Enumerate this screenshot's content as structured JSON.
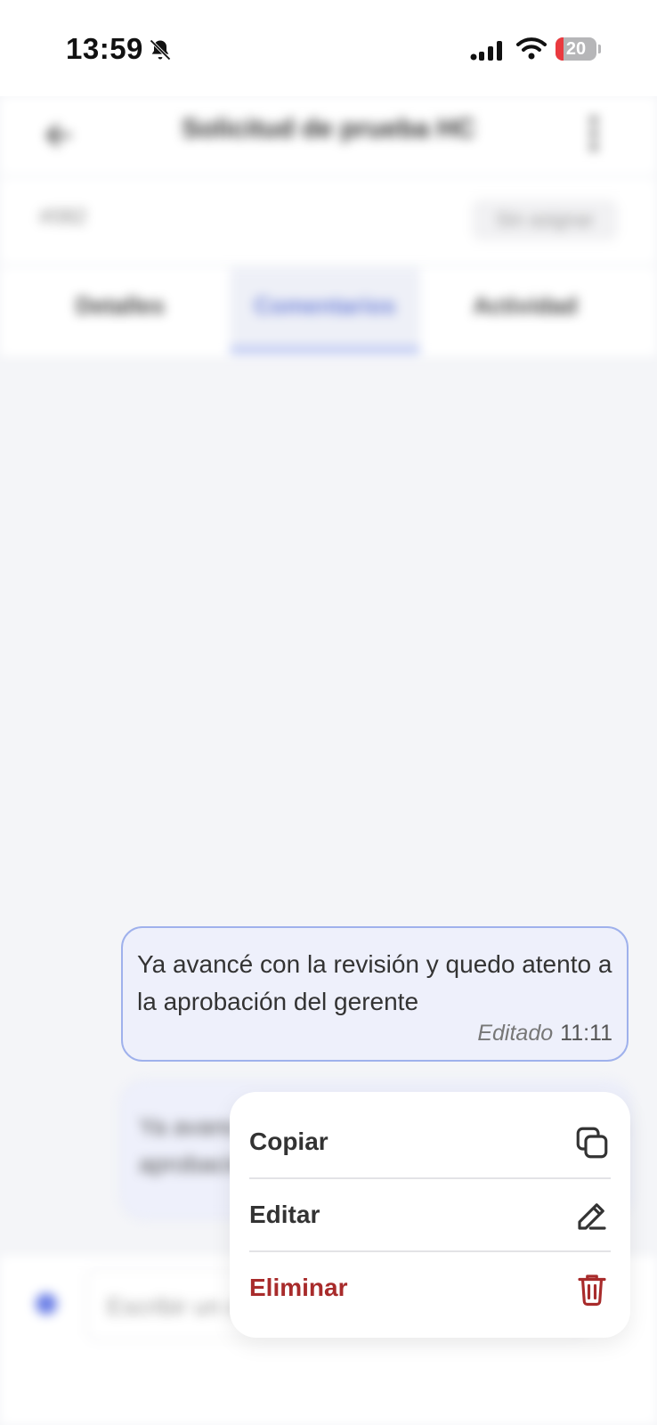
{
  "status_bar": {
    "time": "13:59",
    "battery": "20",
    "battery_level": 0.2
  },
  "header": {
    "title": "Solicitud de prueba HC"
  },
  "info": {
    "ticket_id": "#082",
    "assignee": "Sin asignar"
  },
  "tabs": [
    {
      "label": "Detalles"
    },
    {
      "label": "Comentarios"
    },
    {
      "label": "Actividad"
    }
  ],
  "messages": [
    {
      "text": "Ya avancé con la revisión y quedo atento a la aprobación del gerente",
      "edited_label": "Editado",
      "time": "11:11"
    },
    {
      "text": "Ya avancé con la revisión y quedo atento a la aprobación del gerente"
    }
  ],
  "composer": {
    "placeholder": "Escribir un comentario..."
  },
  "context_menu": {
    "copy": "Copiar",
    "edit": "Editar",
    "delete": "Eliminar"
  },
  "colors": {
    "accent": "#6f82d8",
    "bubble_bg": "#eef0fb",
    "bubble_border": "#9fb1ec",
    "danger": "#a82b2b"
  }
}
